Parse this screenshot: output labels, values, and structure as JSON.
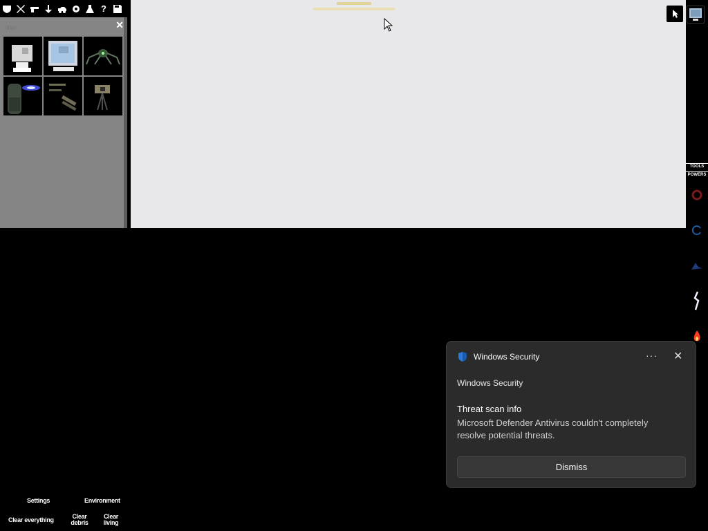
{
  "toolbar": {
    "icons": [
      "category-icon",
      "explosives-icon",
      "firearms-icon",
      "melee-icon",
      "vehicles-icon",
      "machinery-icon",
      "lab-icon",
      "help-icon",
      "save-icon"
    ],
    "help_glyph": "?"
  },
  "spawn_panel": {
    "filter_placeholder": "filter",
    "close_glyph": "✕",
    "items": [
      "white-computer-item",
      "blue-monitor-item",
      "spider-drone-item",
      "laser-turret-item",
      "rail-parts-item",
      "camera-on-tripod-item"
    ]
  },
  "right_panel": {
    "tools_tab": "TOOLS",
    "powers_tab": "POWERS",
    "powers": [
      "red-swirl-power",
      "blue-vortex-power",
      "blue-creature-power",
      "lightning-power",
      "fire-power"
    ]
  },
  "bottom_menu": {
    "settings": "Settings",
    "environment": "Environment",
    "clear_everything": "Clear everything",
    "clear_debris_1": "Clear",
    "clear_debris_2": "debris",
    "clear_living_1": "Clear",
    "clear_living_2": "living"
  },
  "notification": {
    "app_name": "Windows Security",
    "more_glyph": "···",
    "close_glyph": "✕",
    "source": "Windows Security",
    "title": "Threat scan info",
    "body": "Microsoft Defender Antivirus couldn't completely resolve potential threats.",
    "dismiss_label": "Dismiss"
  },
  "colors": {
    "canvas_bg": "#e8e8ea",
    "panel_bg": "#858585",
    "toast_bg": "#2b2b2b",
    "defender_blue": "#2b79d8"
  }
}
